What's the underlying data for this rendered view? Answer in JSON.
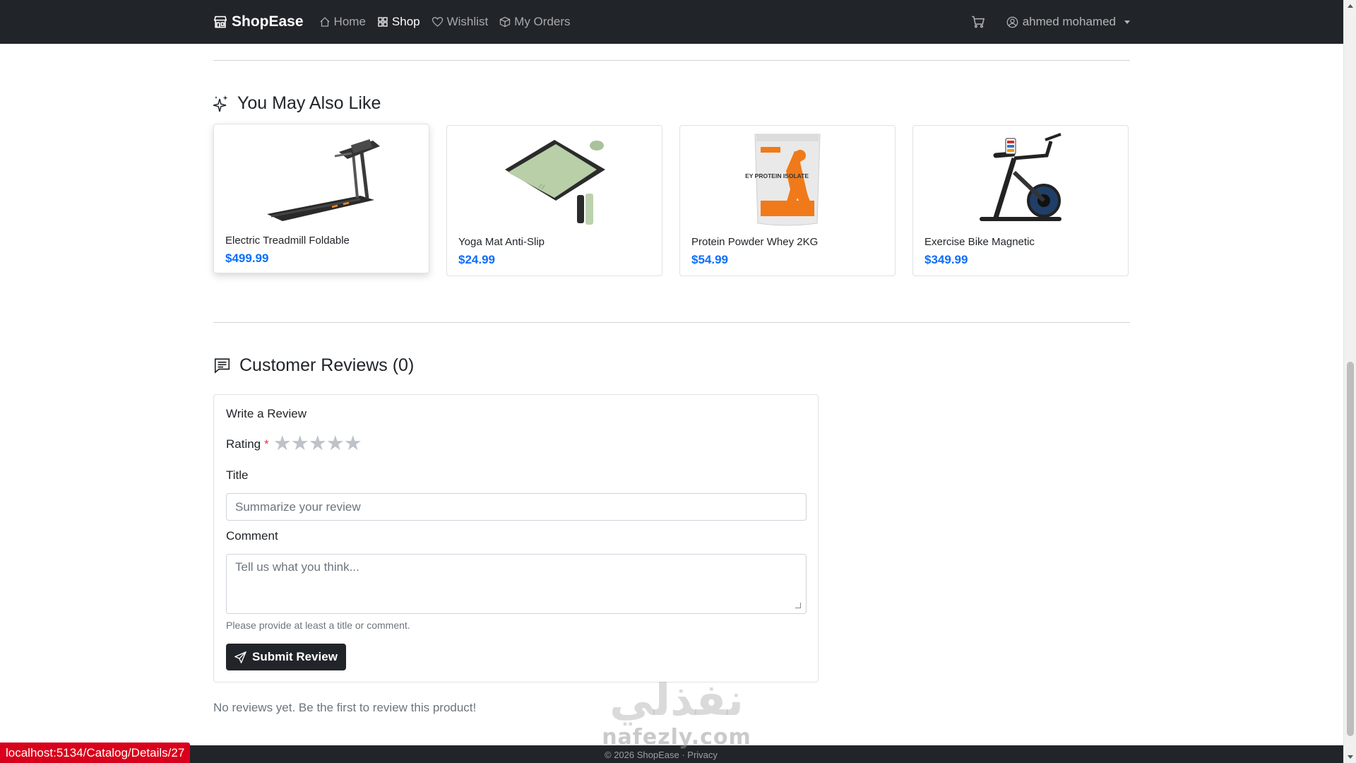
{
  "navbar": {
    "brand": "ShopEase",
    "links": [
      {
        "label": "Home",
        "icon": "house-icon"
      },
      {
        "label": "Shop",
        "icon": "grid-icon"
      },
      {
        "label": "Wishlist",
        "icon": "heart-icon"
      },
      {
        "label": "My Orders",
        "icon": "box-icon"
      }
    ],
    "user_name": "ahmed mohamed"
  },
  "recommendations": {
    "title": "You May Also Like",
    "products": [
      {
        "name": "Electric Treadmill Foldable",
        "price": "$499.99",
        "image": "treadmill"
      },
      {
        "name": "Yoga Mat Anti-Slip",
        "price": "$24.99",
        "image": "yoga-mat"
      },
      {
        "name": "Protein Powder Whey 2KG",
        "price": "$54.99",
        "image": "protein-powder",
        "package_text": "WHEY PROTEIN ISOLATE"
      },
      {
        "name": "Exercise Bike Magnetic",
        "price": "$349.99",
        "image": "exercise-bike"
      }
    ]
  },
  "reviews": {
    "title": "Customer Reviews (0)",
    "form_title": "Write a Review",
    "rating_label": "Rating",
    "required_mark": "*",
    "rating_value": 0,
    "rating_max": 5,
    "title_label": "Title",
    "title_placeholder": "Summarize your review",
    "comment_label": "Comment",
    "comment_placeholder": "Tell us what you think...",
    "help_text": "Please provide at least a title or comment.",
    "submit_label": "Submit Review",
    "empty_text": "No reviews yet. Be the first to review this product!"
  },
  "footer": {
    "text": "© 2026 ShopEase · Privacy"
  },
  "watermark": {
    "arabic": "نفذلي",
    "latin": "nafezly.com"
  },
  "status_bar": {
    "url": "localhost:5134/Catalog/Details/27"
  },
  "colors": {
    "navbar_bg": "#212529",
    "price": "#0d6efd",
    "required": "#dc3545",
    "status_bar": "#d9001b"
  }
}
